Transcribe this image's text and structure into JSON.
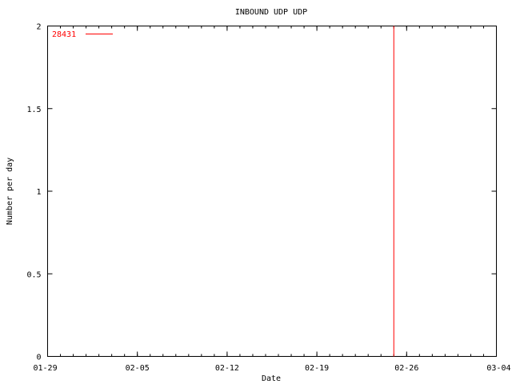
{
  "chart_data": {
    "type": "line",
    "title": "INBOUND UDP UDP",
    "xlabel": "Date",
    "ylabel": "Number per day",
    "x_ticks": [
      "01-29",
      "02-05",
      "02-12",
      "02-19",
      "02-26",
      "03-04"
    ],
    "x_range": [
      "01-29",
      "03-04"
    ],
    "y_ticks": [
      "0",
      "0.5",
      "1",
      "1.5",
      "2"
    ],
    "ylim": [
      0,
      2
    ],
    "grid": false,
    "legend_position": "top-left",
    "series": [
      {
        "name": "28431",
        "color": "#ff0000",
        "points": [
          {
            "x": "02-25",
            "y": 0
          },
          {
            "x": "02-25",
            "y": 2
          }
        ]
      }
    ]
  }
}
